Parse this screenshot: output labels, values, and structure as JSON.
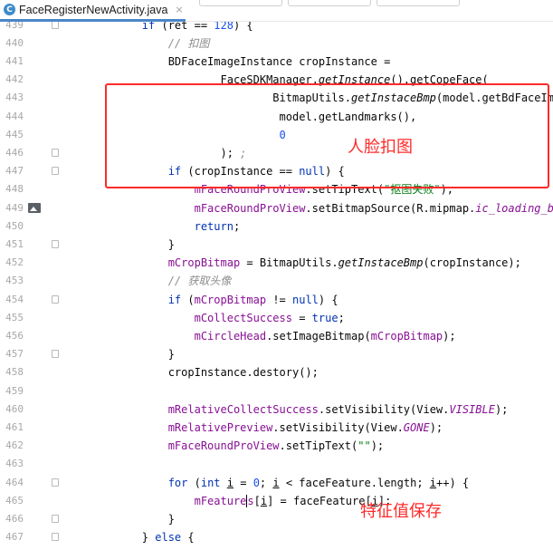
{
  "tab": {
    "filename": "FaceRegisterNewActivity.java",
    "badge": "C",
    "close": "×"
  },
  "annotations": {
    "crop": "人脸扣图",
    "feature": "特征值保存"
  },
  "lines": [
    {
      "n": "439",
      "segs": [
        [
          "",
          "        "
        ],
        [
          "kw",
          "if"
        ],
        [
          "",
          " (ret == "
        ],
        [
          "num",
          "128"
        ],
        [
          "",
          ") {"
        ]
      ]
    },
    {
      "n": "440",
      "segs": [
        [
          "",
          "            "
        ],
        [
          "cmt",
          "// 扣图"
        ]
      ]
    },
    {
      "n": "441",
      "segs": [
        [
          "",
          "            BDFaceImageInstance cropInstance ="
        ]
      ]
    },
    {
      "n": "442",
      "segs": [
        [
          "",
          "                    FaceSDKManager."
        ],
        [
          "ital",
          "getInstance"
        ],
        [
          "",
          "().getCopeFace("
        ]
      ]
    },
    {
      "n": "443",
      "segs": [
        [
          "",
          "                            BitmapUtils."
        ],
        [
          "ital",
          "getInstaceBmp"
        ],
        [
          "",
          "(model.getBdFaceImageInstance()) ,"
        ]
      ]
    },
    {
      "n": "444",
      "segs": [
        [
          "",
          "                             model.getLandmarks(),"
        ]
      ]
    },
    {
      "n": "445",
      "segs": [
        [
          "",
          "                             "
        ],
        [
          "num",
          "0"
        ]
      ]
    },
    {
      "n": "446",
      "segs": [
        [
          "",
          "                    ); "
        ],
        [
          "cmt",
          ";"
        ]
      ]
    },
    {
      "n": "447",
      "segs": [
        [
          "",
          "            "
        ],
        [
          "kw",
          "if"
        ],
        [
          "",
          " (cropInstance == "
        ],
        [
          "kw",
          "null"
        ],
        [
          "",
          ") {"
        ]
      ]
    },
    {
      "n": "448",
      "segs": [
        [
          "",
          "                "
        ],
        [
          "field",
          "mFaceRoundProView"
        ],
        [
          "",
          ".setTipText("
        ],
        [
          "str",
          "\"抠图失败\""
        ],
        [
          "",
          ");"
        ]
      ]
    },
    {
      "n": "449",
      "segs": [
        [
          "",
          "                "
        ],
        [
          "field",
          "mFaceRoundProView"
        ],
        [
          "",
          ".setBitmapSource(R.mipmap."
        ],
        [
          "const",
          "ic_loading_blue"
        ],
        [
          "",
          " , "
        ],
        [
          "kw",
          "true"
        ],
        [
          "",
          ");"
        ]
      ]
    },
    {
      "n": "450",
      "segs": [
        [
          "",
          "                "
        ],
        [
          "kw",
          "return"
        ],
        [
          "",
          ";"
        ]
      ]
    },
    {
      "n": "451",
      "segs": [
        [
          "",
          "            }"
        ]
      ]
    },
    {
      "n": "452",
      "segs": [
        [
          "",
          "            "
        ],
        [
          "field",
          "mCropBitmap"
        ],
        [
          "",
          " = BitmapUtils."
        ],
        [
          "ital",
          "getInstaceBmp"
        ],
        [
          "",
          "(cropInstance);"
        ]
      ]
    },
    {
      "n": "453",
      "segs": [
        [
          "",
          "            "
        ],
        [
          "cmt",
          "// 获取头像"
        ]
      ]
    },
    {
      "n": "454",
      "segs": [
        [
          "",
          "            "
        ],
        [
          "kw",
          "if"
        ],
        [
          "",
          " ("
        ],
        [
          "field",
          "mCropBitmap"
        ],
        [
          "",
          " != "
        ],
        [
          "kw",
          "null"
        ],
        [
          "",
          ") {"
        ]
      ]
    },
    {
      "n": "455",
      "segs": [
        [
          "",
          "                "
        ],
        [
          "field",
          "mCollectSuccess"
        ],
        [
          "",
          " = "
        ],
        [
          "kw",
          "true"
        ],
        [
          "",
          ";"
        ]
      ]
    },
    {
      "n": "456",
      "segs": [
        [
          "",
          "                "
        ],
        [
          "field",
          "mCircleHead"
        ],
        [
          "",
          ".setImageBitmap("
        ],
        [
          "field",
          "mCropBitmap"
        ],
        [
          "",
          ");"
        ]
      ]
    },
    {
      "n": "457",
      "segs": [
        [
          "",
          "            }"
        ]
      ]
    },
    {
      "n": "458",
      "segs": [
        [
          "",
          "            cropInstance.destory();"
        ]
      ]
    },
    {
      "n": "459",
      "segs": []
    },
    {
      "n": "460",
      "segs": [
        [
          "",
          "            "
        ],
        [
          "field",
          "mRelativeCollectSuccess"
        ],
        [
          "",
          ".setVisibility(View."
        ],
        [
          "const",
          "VISIBLE"
        ],
        [
          "",
          ");"
        ]
      ]
    },
    {
      "n": "461",
      "segs": [
        [
          "",
          "            "
        ],
        [
          "field",
          "mRelativePreview"
        ],
        [
          "",
          ".setVisibility(View."
        ],
        [
          "const",
          "GONE"
        ],
        [
          "",
          ");"
        ]
      ]
    },
    {
      "n": "462",
      "segs": [
        [
          "",
          "            "
        ],
        [
          "field",
          "mFaceRoundProView"
        ],
        [
          "",
          ".setTipText("
        ],
        [
          "str",
          "\"\""
        ],
        [
          "",
          ");"
        ]
      ]
    },
    {
      "n": "463",
      "segs": []
    },
    {
      "n": "464",
      "segs": [
        [
          "",
          "            "
        ],
        [
          "kw",
          "for"
        ],
        [
          "",
          " ("
        ],
        [
          "kw",
          "int"
        ],
        [
          "",
          " "
        ],
        [
          "ul",
          "i"
        ],
        [
          "",
          " = "
        ],
        [
          "num",
          "0"
        ],
        [
          "",
          "; "
        ],
        [
          "ul",
          "i"
        ],
        [
          "",
          " < faceFeature.length; "
        ],
        [
          "ul",
          "i"
        ],
        [
          "",
          "++) {"
        ]
      ]
    },
    {
      "n": "465",
      "segs": [
        [
          "",
          "                "
        ],
        [
          "field",
          "mFeature"
        ],
        [
          "caret",
          ""
        ],
        [
          "field",
          "s"
        ],
        [
          "",
          "["
        ],
        [
          "ul",
          "i"
        ],
        [
          "",
          "] = faceFeature["
        ],
        [
          "ul",
          "i"
        ],
        [
          "",
          "];"
        ]
      ]
    },
    {
      "n": "466",
      "segs": [
        [
          "",
          "            }"
        ]
      ]
    },
    {
      "n": "467",
      "segs": [
        [
          "",
          "        } "
        ],
        [
          "kw",
          "else"
        ],
        [
          "",
          " {"
        ]
      ]
    }
  ]
}
